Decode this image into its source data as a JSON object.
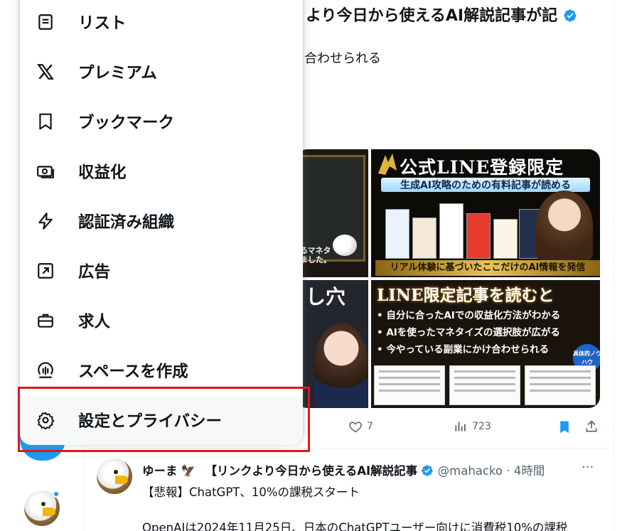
{
  "post": {
    "title": "より今日から使えるAI解説記事が記",
    "subtitle": "合わせられる",
    "actions": {
      "likes": "7",
      "views": "723"
    }
  },
  "media": {
    "tile_a_text": "るマネタ\nました。",
    "tile_b": {
      "title": "公式LINE登録限定",
      "subtitle": "生成AI攻略のための有料記事が読める",
      "banner": "リアル体験に基づいたここだけのAI情報を発信"
    },
    "tile_c_title": "し穴",
    "tile_d": {
      "title": "LINE限定記事を読むと",
      "bullets": [
        "• 自分に合ったAIでの収益化方法がわかる",
        "• AIを使ったマネタイズの選択肢が広がる",
        "• 今やっている副業にかけ合わせられる"
      ],
      "seal": "具体的ノウハウ"
    }
  },
  "post2": {
    "name": "ゆーま",
    "title": "【リンクより今日から使えるAI解説記事",
    "handle": "@mahacko",
    "time": "· 4時間",
    "more": "···",
    "line1": "【悲報】ChatGPT、10%の課税スタート",
    "line2": "OpenAIは2024年11月25日、日本のChatGPTユーザー向けに消費税10%の課税"
  },
  "menu": {
    "items": [
      {
        "label": "リスト",
        "icon": "list-icon"
      },
      {
        "label": "プレミアム",
        "icon": "x-logo-icon"
      },
      {
        "label": "ブックマーク",
        "icon": "bookmark-icon"
      },
      {
        "label": "収益化",
        "icon": "money-icon"
      },
      {
        "label": "認証済み組織",
        "icon": "lightning-icon"
      },
      {
        "label": "広告",
        "icon": "ads-arrow-icon"
      },
      {
        "label": "求人",
        "icon": "briefcase-icon"
      },
      {
        "label": "スペースを作成",
        "icon": "spaces-mic-icon"
      },
      {
        "label": "設定とプライバシー",
        "icon": "gear-icon"
      }
    ]
  },
  "colors": {
    "accent": "#1d9bf0",
    "highlight": "#e0161d",
    "text": "#0f1419",
    "muted": "#536471"
  }
}
